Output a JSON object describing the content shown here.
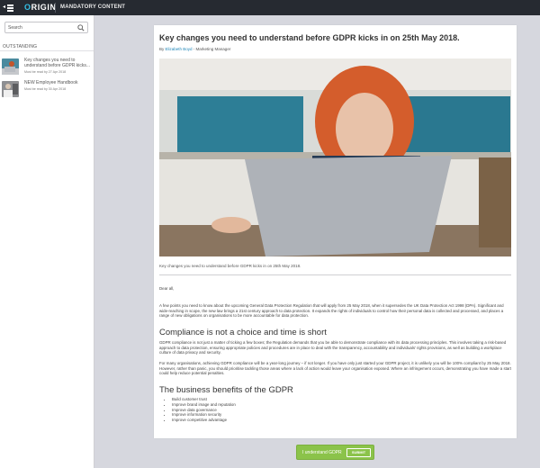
{
  "topbar": {
    "logo_first": "O",
    "logo_rest": "RIGIN",
    "title": "MANDATORY CONTENT",
    "menu_icon": "hamburger-icon",
    "colors": {
      "bar": "#262a31",
      "logo_accent": "#35c0e6"
    }
  },
  "sidebar": {
    "search": {
      "placeholder": "Search",
      "icon": "search-icon"
    },
    "section_header": "OUTSTANDING",
    "items": [
      {
        "title": "Key changes you need to understand before GDPR kicks...",
        "due": "Must be read by 27 Apr 2018"
      },
      {
        "title": "NEW Employee Handbook",
        "due": "Must be read by 30 Apr 2018"
      }
    ]
  },
  "article": {
    "title": "Key changes you need to understand before GDPR kicks in on 25th May 2018.",
    "byline_prefix": "By ",
    "author": "Elizabeth Boyd",
    "author_role": " - Marketing Manager",
    "caption": "Key changes you need to understand before GDPR kicks in on 25th May 2018.",
    "greeting": "Dear all,",
    "intro": "A few points you need to know about the upcoming General Data Protection Regulation that will apply from 25 May 2018, when it supersedes the UK Data Protection Act 1998 (DPA). Significant and wide-reaching in scope, the new law brings a 21st century approach to data protection. It expands the rights of individuals to control how their personal data is collected and processed, and places a range of new obligations on organisations to be more accountable for data protection.",
    "section1_heading": "Compliance is not a choice and time is short",
    "section1_p1": "GDPR compliance is not just a matter of ticking a few boxes; the Regulation demands that you be able to demonstrate compliance with its data processing principles. This involves taking a risk-based approach to data protection, ensuring appropriate policies and procedures are in place to deal with the transparency, accountability and individuals' rights provisions, as well as building a workplace culture of data privacy and security.",
    "section1_p2": "For many organisations, achieving GDPR compliance will be a year-long journey – if not longer. If you have only just started your GDPR project, it is unlikely you will be 100% compliant by 25 May 2018. However, rather than panic, you should prioritise tackling those areas where a lack of action would leave your organisation exposed. Where an infringement occurs, demonstrating you have made a start could help reduce potential penalties.",
    "section2_heading": "The business benefits of the GDPR",
    "benefits": [
      "Build customer trust",
      "Improve brand image and reputation",
      "Improve data governance",
      "Improve information security",
      "Improve competitive advantage"
    ]
  },
  "footer": {
    "confirm_label": "I understand GDPR",
    "submit_label": "SUBMIT",
    "colors": {
      "button_bg": "#8bc34a"
    }
  }
}
